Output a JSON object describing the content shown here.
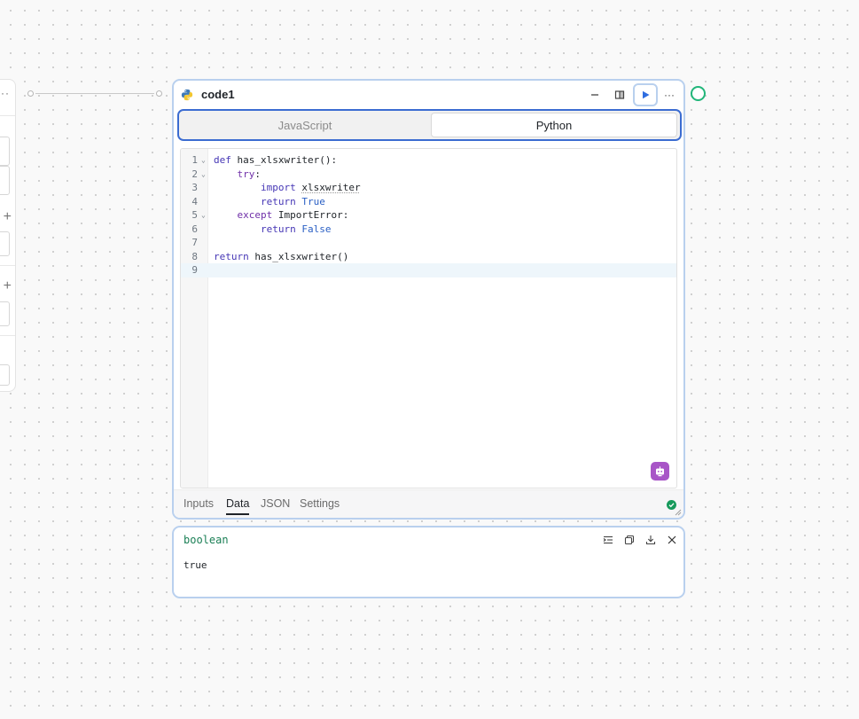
{
  "node": {
    "title": "code1",
    "language_tabs": [
      {
        "label": "JavaScript",
        "active": false
      },
      {
        "label": "Python",
        "active": true
      }
    ],
    "icons": {
      "language": "python-icon",
      "minimize": "minimize-icon",
      "layout": "panel-layout-icon",
      "run": "play-icon",
      "more": "more-horizontal-icon",
      "ai": "robot-icon",
      "status": "check-circle-icon"
    }
  },
  "editor": {
    "lines": [
      {
        "n": "1",
        "fold": true
      },
      {
        "n": "2",
        "fold": true
      },
      {
        "n": "3",
        "fold": false
      },
      {
        "n": "4",
        "fold": false
      },
      {
        "n": "5",
        "fold": true
      },
      {
        "n": "6",
        "fold": false
      },
      {
        "n": "7",
        "fold": false
      },
      {
        "n": "8",
        "fold": false
      },
      {
        "n": "9",
        "fold": false
      }
    ],
    "tokens": {
      "l1_kw": "def",
      "l1_rest": " has_xlsxwriter():",
      "l2_kw": "try",
      "l2_rest": ":",
      "l3_kw": "import",
      "l3_mod": "xlsxwriter",
      "l4_kw": "return",
      "l4_val": "True",
      "l5_kw": "except",
      "l5_rest": " ImportError:",
      "l6_kw": "return",
      "l6_val": "False",
      "l8_kw": "return",
      "l8_rest": " has_xlsxwriter()"
    },
    "current_line": "9"
  },
  "footer_tabs": [
    {
      "label": "Inputs",
      "active": false
    },
    {
      "label": "Data",
      "active": true
    },
    {
      "label": "JSON",
      "active": false
    },
    {
      "label": "Settings",
      "active": false
    }
  ],
  "result": {
    "type": "boolean",
    "value": "true",
    "icons": [
      "wrap-lines-icon",
      "copy-icon",
      "download-icon",
      "close-icon"
    ]
  },
  "colors": {
    "accent": "#3b6cd1",
    "card_border": "#b9d0ee",
    "success": "#179a5c",
    "output_handle": "#22b67a",
    "ai_button": "#a855c7"
  }
}
